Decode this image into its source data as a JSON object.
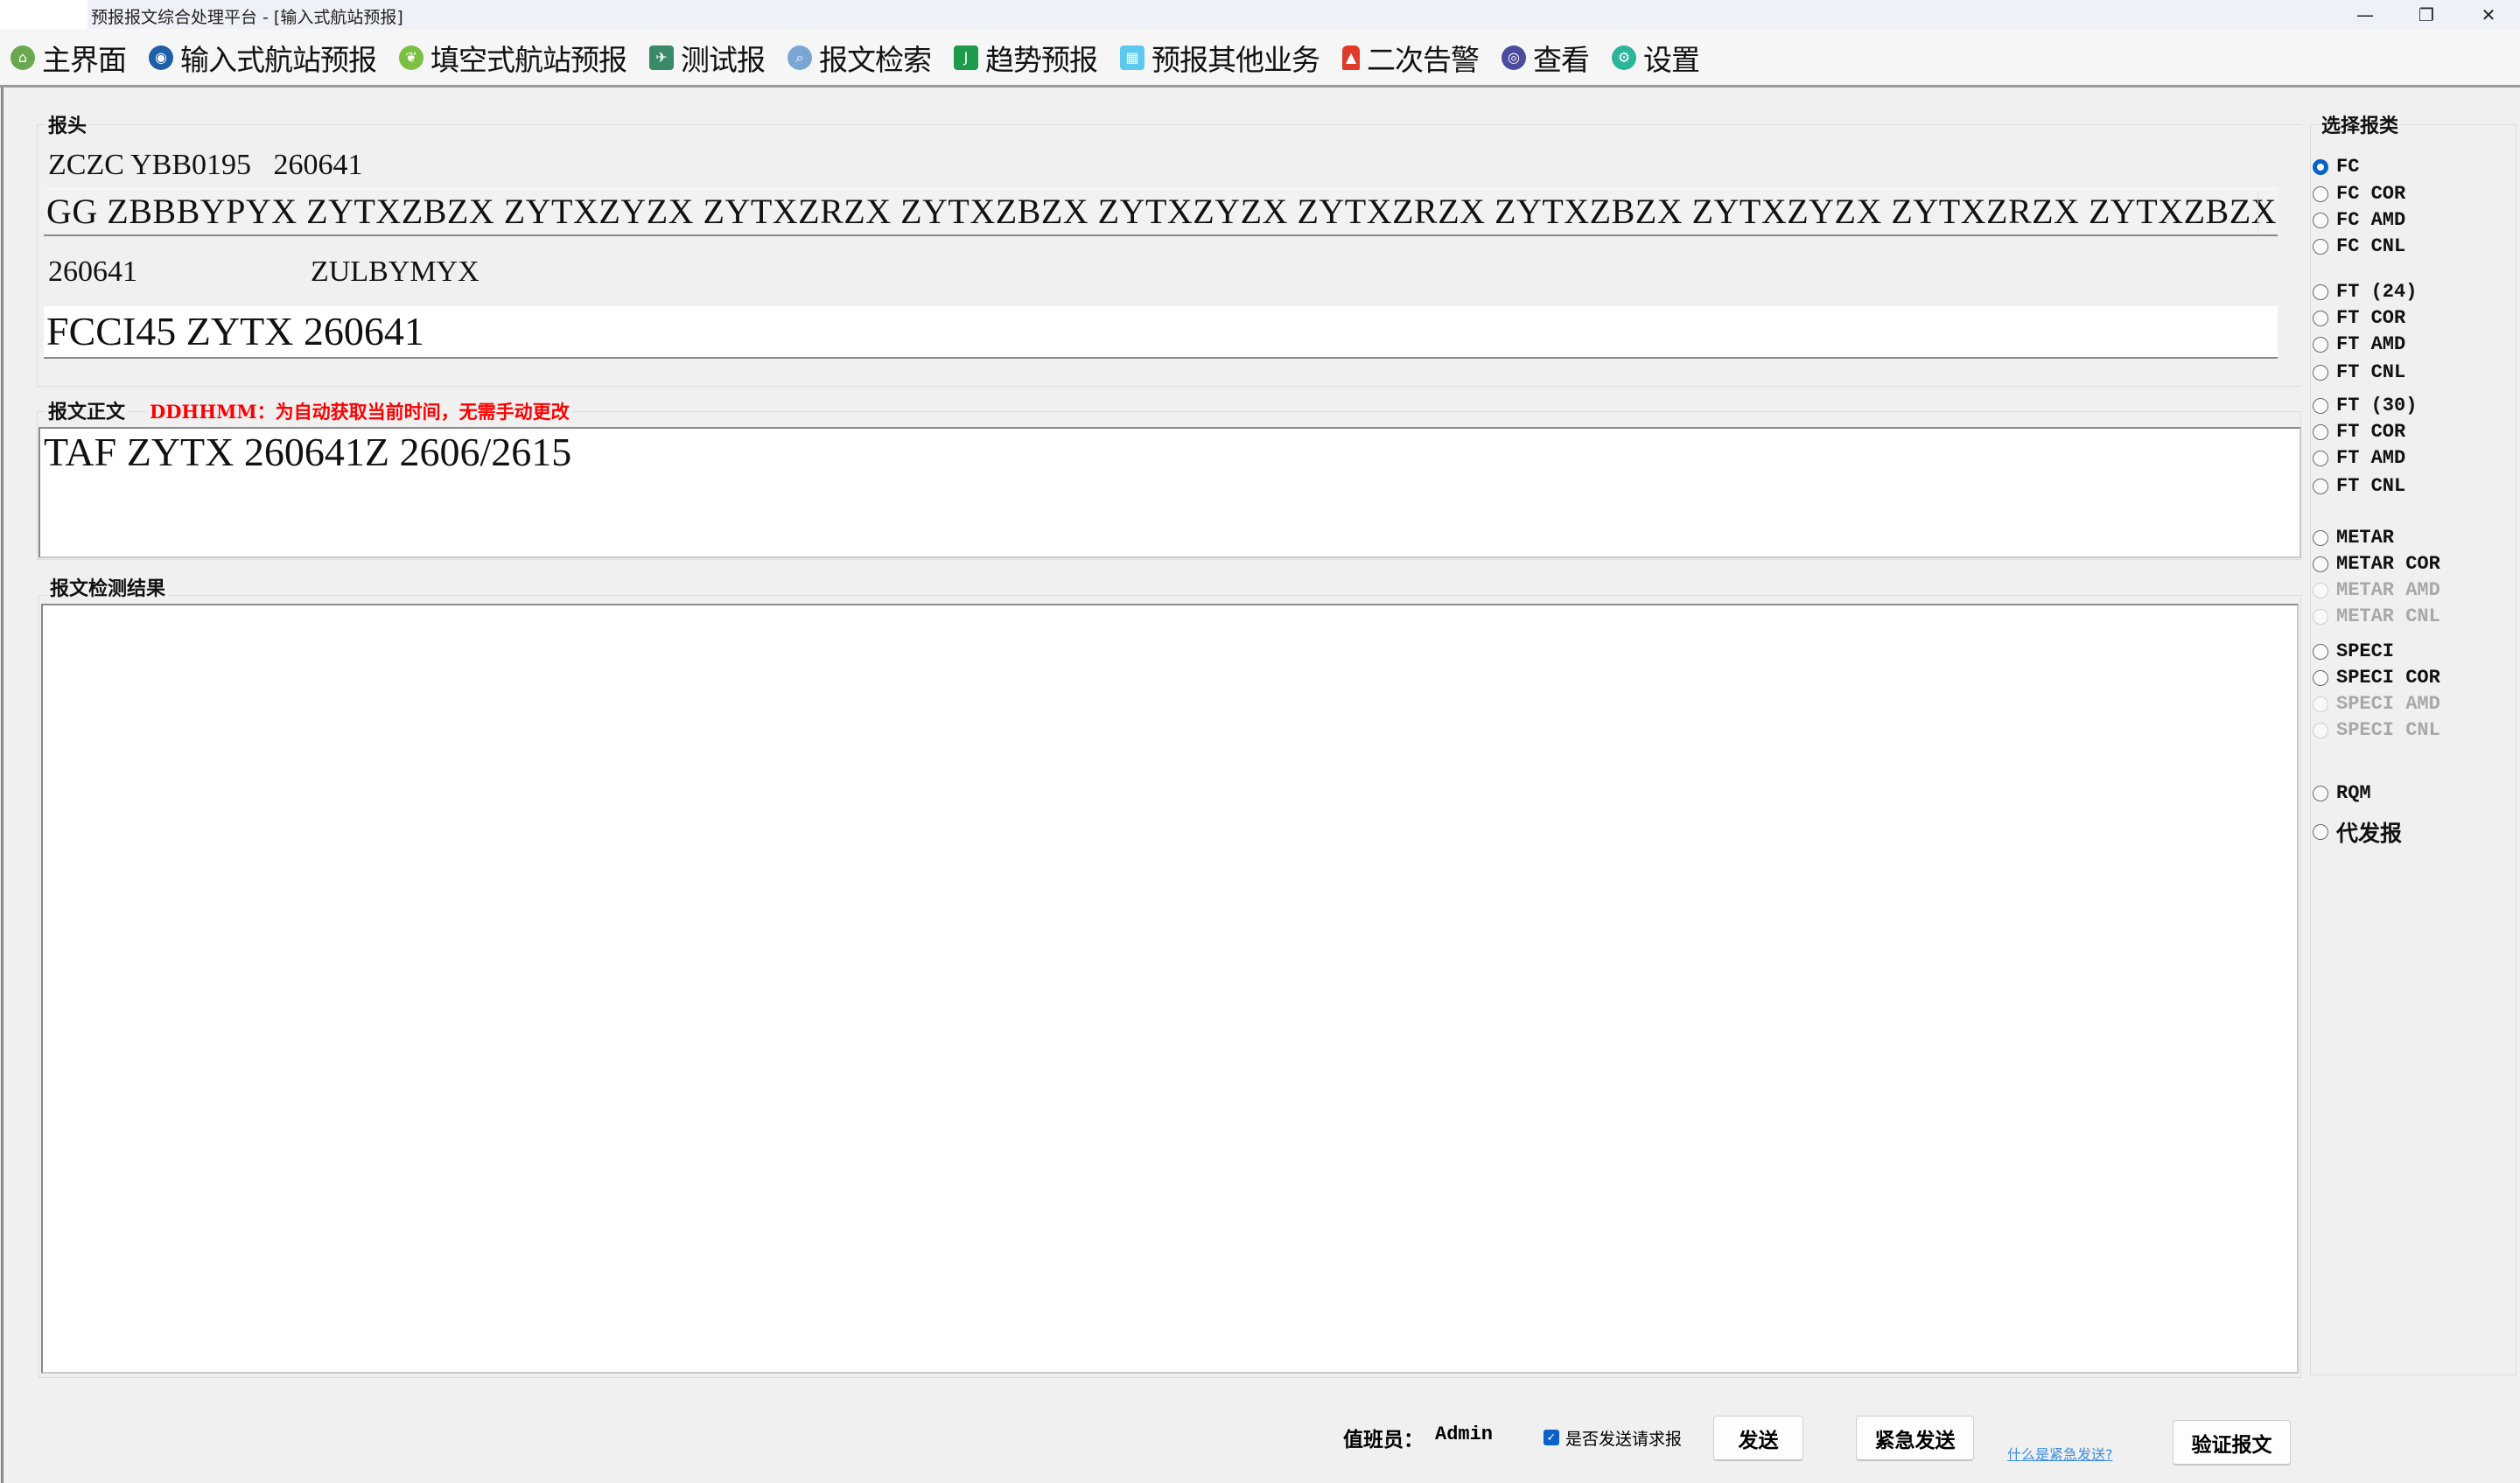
{
  "window": {
    "title": "预报报文综合处理平台 - [输入式航站预报]",
    "minimize_glyph": "—",
    "maximize_glyph": "❐",
    "close_glyph": "✕"
  },
  "toolbar": {
    "items": [
      {
        "label": "主界面",
        "icon": "home-icon",
        "color": "#6aa84f"
      },
      {
        "label": "输入式航站预报",
        "icon": "target-icon",
        "color": "#1f5fa8"
      },
      {
        "label": "填空式航站预报",
        "icon": "leaf-icon",
        "color": "#7cc043"
      },
      {
        "label": "测试报",
        "icon": "test-icon",
        "color": "#3a8a6a"
      },
      {
        "label": "报文检索",
        "icon": "magnifier-icon",
        "color": "#7aa6d6"
      },
      {
        "label": "趋势预报",
        "icon": "trend-icon",
        "color": "#1e9b4a"
      },
      {
        "label": "预报其他业务",
        "icon": "grid-icon",
        "color": "#5fc8ee"
      },
      {
        "label": "二次告警",
        "icon": "alarm-light-icon",
        "color": "#e03a2a"
      },
      {
        "label": "查看",
        "icon": "view-icon",
        "color": "#4b4c9e"
      },
      {
        "label": "设置",
        "icon": "gear-icon",
        "color": "#2bb59a"
      }
    ]
  },
  "header_group": {
    "label": "报头",
    "line1": "ZCZC YBB0195   260641",
    "line2": "GG ZBBBYPYX ZYTXZBZX ZYTXZYZX ZYTXZRZX ZYTXZBZX ZYTXZYZX ZYTXZRZX ZYTXZBZX ZYTXZYZX ZYTXZRZX ZYTXZBZX",
    "line3_time": "260641",
    "line3_originator": "ZULBYMYX",
    "line4": "FCCI45 ZYTX 260641"
  },
  "body_group": {
    "label": "报文正文",
    "note": "DDHHMM：为自动获取当前时间，无需手动更改",
    "note_color": "#ff0000",
    "text": "TAF ZYTX 260641Z 2606/2615"
  },
  "result_group": {
    "label": "报文检测结果",
    "text": ""
  },
  "report_type": {
    "label": "选择报类",
    "selected": "FC",
    "options": [
      {
        "label": "FC",
        "checked": true,
        "disabled": false
      },
      {
        "label": "FC COR",
        "checked": false,
        "disabled": false
      },
      {
        "label": "FC AMD",
        "checked": false,
        "disabled": false
      },
      {
        "label": "FC CNL",
        "checked": false,
        "disabled": false
      },
      {
        "label": "FT (24)",
        "checked": false,
        "disabled": false
      },
      {
        "label": "FT COR",
        "checked": false,
        "disabled": false
      },
      {
        "label": "FT AMD",
        "checked": false,
        "disabled": false
      },
      {
        "label": "FT CNL",
        "checked": false,
        "disabled": false
      },
      {
        "label": "FT (30)",
        "checked": false,
        "disabled": false
      },
      {
        "label": "FT COR",
        "checked": false,
        "disabled": false
      },
      {
        "label": "FT AMD",
        "checked": false,
        "disabled": false
      },
      {
        "label": "FT CNL",
        "checked": false,
        "disabled": false
      },
      {
        "label": "METAR",
        "checked": false,
        "disabled": false
      },
      {
        "label": "METAR COR",
        "checked": false,
        "disabled": false
      },
      {
        "label": "METAR AMD",
        "checked": false,
        "disabled": true
      },
      {
        "label": "METAR CNL",
        "checked": false,
        "disabled": true
      },
      {
        "label": "SPECI",
        "checked": false,
        "disabled": false
      },
      {
        "label": "SPECI COR",
        "checked": false,
        "disabled": false
      },
      {
        "label": "SPECI AMD",
        "checked": false,
        "disabled": true
      },
      {
        "label": "SPECI CNL",
        "checked": false,
        "disabled": true
      },
      {
        "label": "RQM",
        "checked": false,
        "disabled": false
      },
      {
        "label": "代发报",
        "checked": false,
        "disabled": false
      }
    ]
  },
  "footer": {
    "duty_label": "值班员：",
    "duty_value": "Admin",
    "request_checkbox_label": "是否发送请求报",
    "request_checkbox_checked": true,
    "send_label": "发送",
    "urgent_send_label": "紧急发送",
    "urgent_help_link": "什么是紧急发送?",
    "verify_label": "验证报文"
  }
}
